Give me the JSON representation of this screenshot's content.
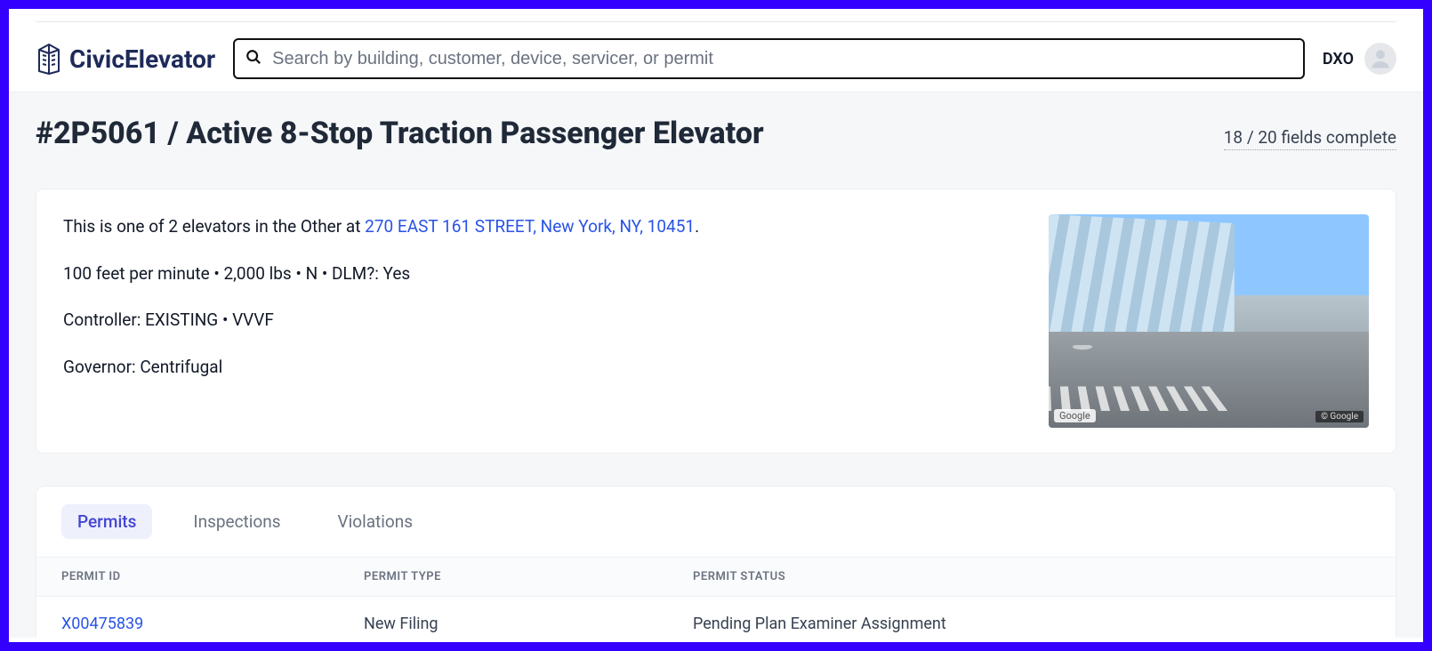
{
  "brand": {
    "name": "CivicElevator"
  },
  "search": {
    "placeholder": "Search by building, customer, device, servicer, or permit"
  },
  "user": {
    "initials": "DXO"
  },
  "page": {
    "title": "#2P5061 / Active 8-Stop Traction Passenger Elevator",
    "fields_complete": "18 / 20 fields complete"
  },
  "info": {
    "line1_prefix": "This is one of 2 elevators in the Other at ",
    "address_link": "270 EAST 161 STREET, New York, NY, 10451",
    "line1_suffix": ".",
    "line2": "100 feet per minute • 2,000 lbs • N • DLM?: Yes",
    "line3": "Controller: EXISTING • VVVF",
    "line4": "Governor: Centrifugal",
    "thumb_attrib1": "Google",
    "thumb_attrib2": "© Google"
  },
  "tabs": {
    "items": [
      "Permits",
      "Inspections",
      "Violations"
    ],
    "active_index": 0
  },
  "permits_table": {
    "headers": {
      "id": "PERMIT ID",
      "type": "PERMIT TYPE",
      "status": "PERMIT STATUS"
    },
    "rows": [
      {
        "id": "X00475839",
        "type": "New Filing",
        "status": "Pending Plan Examiner Assignment"
      }
    ]
  }
}
